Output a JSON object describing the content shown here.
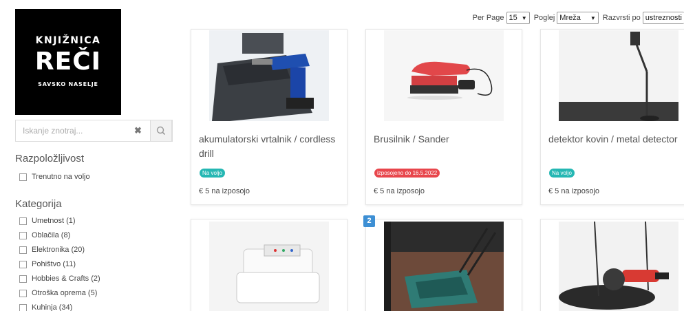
{
  "logo": {
    "line1": "KNJIŽNICA",
    "line2": "REČI",
    "line3": "SAVSKO NASELJE"
  },
  "search": {
    "placeholder": "Iskanje znotraj...",
    "clear_glyph": "✖"
  },
  "availability": {
    "heading": "Razpoložljivost",
    "option": "Trenutno na voljo"
  },
  "category": {
    "heading": "Kategorija",
    "items": [
      "Umetnost (1)",
      "Oblačila (8)",
      "Elektronika (20)",
      "Pohištvo (11)",
      "Hobbies & Crafts (2)",
      "Otroška oprema (5)",
      "Kuhinja (34)"
    ]
  },
  "toolbar": {
    "per_page_label": "Per Page",
    "per_page_value": "15",
    "view_label": "Poglej",
    "view_value": "Mreža",
    "sort_label": "Razvrsti po",
    "sort_value": "ustreznosti"
  },
  "products": [
    {
      "title": "akumulatorski vrtalnik / cordless drill",
      "badge": "Na voljo",
      "badge_color": "#25b7b3",
      "price": "€ 5 na izposojo",
      "icon": "cordless-drill-photo"
    },
    {
      "title": "Brusilnik / Sander",
      "badge": "izposojeno do 16.5.2022",
      "badge_color": "#e8464c",
      "price": "€ 5 na izposojo",
      "icon": "sander-photo"
    },
    {
      "title": "detektor kovin / metal detector",
      "badge": "Na voljo",
      "badge_color": "#25b7b3",
      "price": "€ 5 na izposojo",
      "icon": "metal-detector-photo"
    }
  ],
  "second_row": {
    "page_badge": "2",
    "icons": [
      "sewing-machine-photo",
      "lawn-mower-photo",
      "angle-grinder-photo"
    ]
  }
}
